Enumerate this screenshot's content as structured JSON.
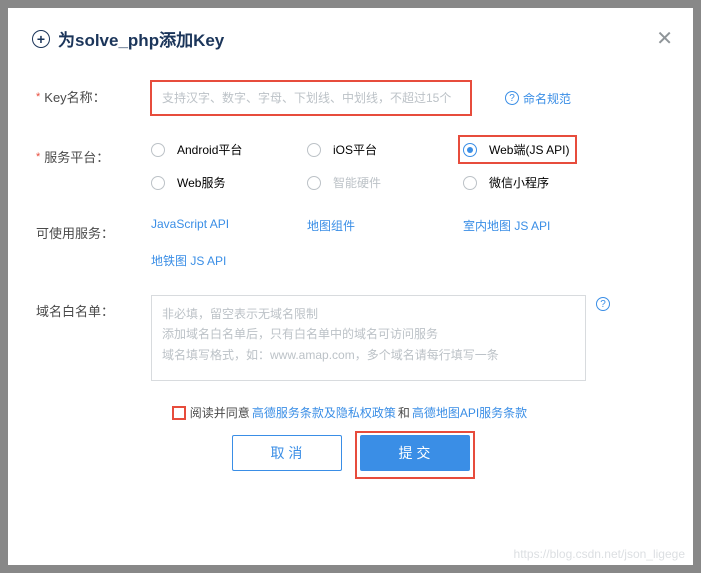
{
  "header": {
    "title": "为solve_php添加Key"
  },
  "fields": {
    "keyName": {
      "label": "Key名称",
      "placeholder": "支持汉字、数字、字母、下划线、中划线，不超过15个",
      "helpLink": "命名规范"
    },
    "platform": {
      "label": "服务平台",
      "options": [
        {
          "id": "android",
          "label": "Android平台",
          "selected": false,
          "disabled": false
        },
        {
          "id": "ios",
          "label": "iOS平台",
          "selected": false,
          "disabled": false
        },
        {
          "id": "webjs",
          "label": "Web端(JS API)",
          "selected": true,
          "disabled": false,
          "highlight": true
        },
        {
          "id": "webservice",
          "label": "Web服务",
          "selected": false,
          "disabled": false
        },
        {
          "id": "smarthw",
          "label": "智能硬件",
          "selected": false,
          "disabled": true
        },
        {
          "id": "wechat",
          "label": "微信小程序",
          "selected": false,
          "disabled": false
        }
      ]
    },
    "services": {
      "label": "可使用服务",
      "items": [
        "JavaScript API",
        "地图组件",
        "室内地图 JS API",
        "地铁图 JS API"
      ]
    },
    "whitelist": {
      "label": "域名白名单",
      "placeholder": "非必填，留空表示无域名限制\n添加域名白名单后，只有白名单中的域名可访问服务\n域名填写格式，如：www.amap.com，多个域名请每行填写一条"
    }
  },
  "agreement": {
    "prefix": "阅读并同意",
    "link1": "高德服务条款及隐私权政策",
    "mid": "和",
    "link2": "高德地图API服务条款"
  },
  "buttons": {
    "cancel": "取 消",
    "submit": "提 交"
  },
  "watermark": "https://blog.csdn.net/json_ligege"
}
